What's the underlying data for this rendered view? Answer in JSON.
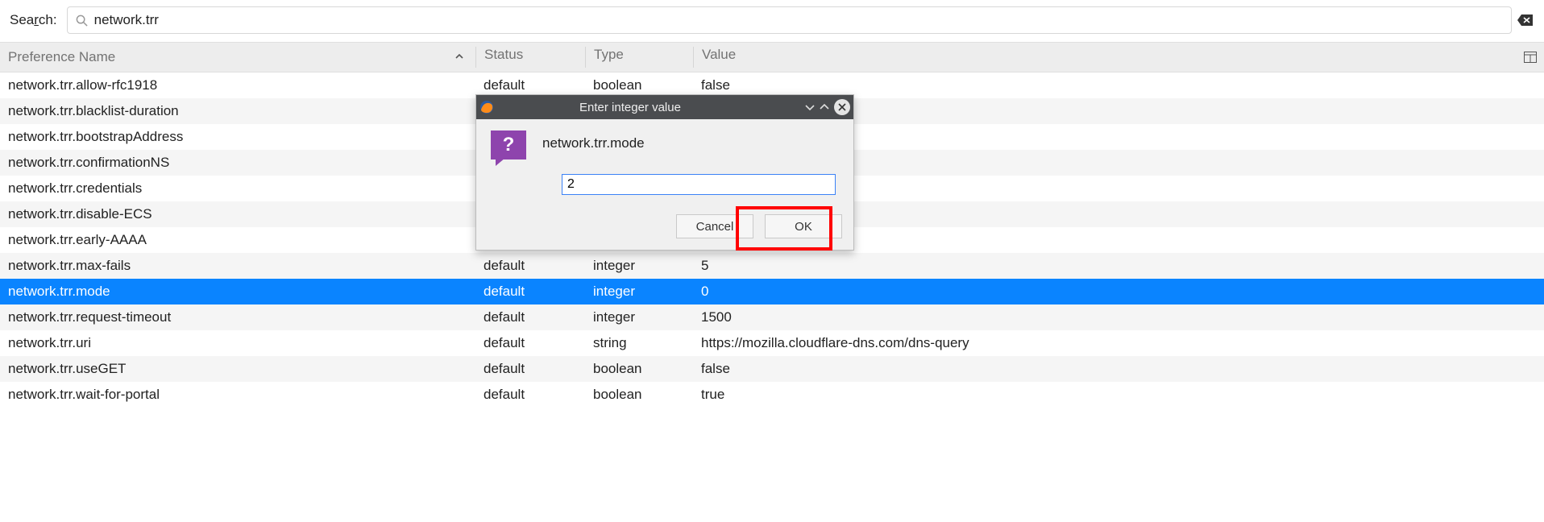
{
  "search": {
    "label_pre": "Sea",
    "label_ul": "r",
    "label_post": "ch:",
    "value": "network.trr"
  },
  "columns": {
    "name": "Preference Name",
    "status": "Status",
    "type": "Type",
    "value": "Value"
  },
  "rows": [
    {
      "name": "network.trr.allow-rfc1918",
      "status": "default",
      "type": "boolean",
      "value": "false",
      "selected": false
    },
    {
      "name": "network.trr.blacklist-duration",
      "status": "",
      "type": "",
      "value": "",
      "selected": false
    },
    {
      "name": "network.trr.bootstrapAddress",
      "status": "",
      "type": "",
      "value": "",
      "selected": false
    },
    {
      "name": "network.trr.confirmationNS",
      "status": "",
      "type": "",
      "value": "",
      "selected": false
    },
    {
      "name": "network.trr.credentials",
      "status": "",
      "type": "",
      "value": "",
      "selected": false
    },
    {
      "name": "network.trr.disable-ECS",
      "status": "",
      "type": "",
      "value": "",
      "selected": false
    },
    {
      "name": "network.trr.early-AAAA",
      "status": "",
      "type": "",
      "value": "",
      "selected": false
    },
    {
      "name": "network.trr.max-fails",
      "status": "default",
      "type": "integer",
      "value": "5",
      "selected": false
    },
    {
      "name": "network.trr.mode",
      "status": "default",
      "type": "integer",
      "value": "0",
      "selected": true
    },
    {
      "name": "network.trr.request-timeout",
      "status": "default",
      "type": "integer",
      "value": "1500",
      "selected": false
    },
    {
      "name": "network.trr.uri",
      "status": "default",
      "type": "string",
      "value": "https://mozilla.cloudflare-dns.com/dns-query",
      "selected": false
    },
    {
      "name": "network.trr.useGET",
      "status": "default",
      "type": "boolean",
      "value": "false",
      "selected": false
    },
    {
      "name": "network.trr.wait-for-portal",
      "status": "default",
      "type": "boolean",
      "value": "true",
      "selected": false
    }
  ],
  "dialog": {
    "title": "Enter integer value",
    "pref": "network.trr.mode",
    "input": "2",
    "cancel": "Cancel",
    "ok": "OK"
  }
}
